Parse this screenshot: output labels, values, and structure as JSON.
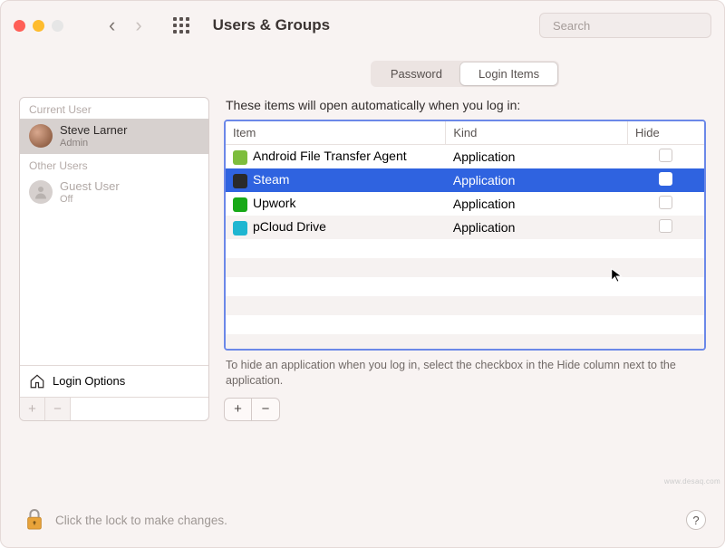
{
  "window": {
    "title": "Users & Groups"
  },
  "search": {
    "placeholder": "Search"
  },
  "sidebar": {
    "sec_current": "Current User",
    "sec_other": "Other Users",
    "current": {
      "name": "Steve Larner",
      "role": "Admin"
    },
    "guest": {
      "name": "Guest User",
      "role": "Off"
    },
    "login_options": "Login Options"
  },
  "tabs": {
    "password": "Password",
    "login_items": "Login Items"
  },
  "hint_top": "These items will open automatically when you log in:",
  "table": {
    "headers": {
      "item": "Item",
      "kind": "Kind",
      "hide": "Hide"
    },
    "rows": [
      {
        "icon_color": "#7dbd3d",
        "name": "Android File Transfer Agent",
        "kind": "Application",
        "selected": false
      },
      {
        "icon_color": "#2a2a2a",
        "name": "Steam",
        "kind": "Application",
        "selected": true
      },
      {
        "icon_color": "#17a917",
        "name": "Upwork",
        "kind": "Application",
        "selected": false
      },
      {
        "icon_color": "#1fb6d1",
        "name": "pCloud Drive",
        "kind": "Application",
        "selected": false
      }
    ]
  },
  "hint_bottom": "To hide an application when you log in, select the checkbox in the Hide column next to the application.",
  "footer": {
    "lock_text": "Click the lock to make changes."
  },
  "buttons": {
    "plus": "+",
    "minus": "−"
  },
  "watermark": "www.desaq.com"
}
